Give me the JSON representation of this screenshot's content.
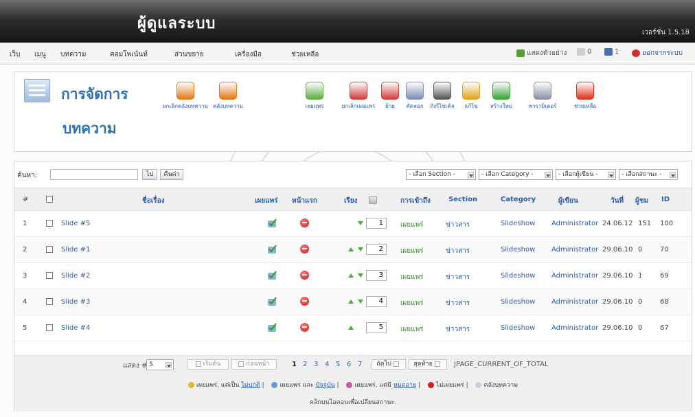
{
  "header": {
    "brand": "ผู้ดูแลระบบ",
    "version": "เวอร์ชั่น 1.5.18"
  },
  "menu": {
    "items": [
      "เว็บ",
      "เมนู",
      "บทความ",
      "คอมโพเน้นท์",
      "ส่วนขยาย",
      "เครื่องมือ",
      "ช่วยเหลือ"
    ],
    "preview": "แสดงตัวอย่าง",
    "messages": "0",
    "users": "1",
    "logout": "ออกจากระบบ"
  },
  "page": {
    "title_line1": "การจัดการ",
    "title_line2": "บทความ"
  },
  "toolbar": [
    {
      "label": "ยกเลิกคลังบทความ",
      "icon": "unarchive-icon",
      "color": "#e07a18"
    },
    {
      "label": "คลังบทความ",
      "icon": "archive-icon",
      "color": "#e07a18"
    },
    {
      "label": "เผยแพร่",
      "icon": "publish-icon",
      "color": "#5bae3f"
    },
    {
      "label": "ยกเลิกเผยแพร่",
      "icon": "unpublish-icon",
      "color": "#d23c3c"
    },
    {
      "label": "ย้าย",
      "icon": "move-icon",
      "color": "#d23c3c"
    },
    {
      "label": "คัดลอก",
      "icon": "copy-icon",
      "color": "#7a8fb5"
    },
    {
      "label": "ถังรีไซเคิล",
      "icon": "trash-icon",
      "color": "#555555"
    },
    {
      "label": "แก้ไข",
      "icon": "edit-icon",
      "color": "#e2a21b"
    },
    {
      "label": "สร้างใหม่",
      "icon": "new-icon",
      "color": "#3aa635"
    },
    {
      "label": "พารามิเตอร์",
      "icon": "params-icon",
      "color": "#8a8fa5"
    },
    {
      "label": "ช่วยเหลือ",
      "icon": "help-icon",
      "color": "#e0321e"
    }
  ],
  "filter": {
    "label": "ค้นหา:",
    "search_value": "",
    "go_label": "ไป",
    "reset_label": "คืนค่า",
    "section": "- เลือก Section -",
    "category": "- เลือก Category -",
    "author": "- เลือกผู้เขียน -",
    "state": "- เลือกสถานะ -"
  },
  "table": {
    "headers": {
      "num": "#",
      "title": "ชื่อเรื่อง",
      "published": "เผยแพร่",
      "frontpage": "หน้าแรก",
      "order": "เรียง",
      "access": "การเข้าถึง",
      "section": "Section",
      "category": "Category",
      "author": "ผู้เขียน",
      "date": "วันที่",
      "hits": "ผู้ชม",
      "id": "ID"
    },
    "rows": [
      {
        "num": "1",
        "title": "Slide #5",
        "order": "1",
        "access": "เผยแพร่",
        "section": "ข่าวสาร",
        "category": "Slideshow",
        "author": "Administrator",
        "date": "24.06.12",
        "hits": "151",
        "id": "100"
      },
      {
        "num": "2",
        "title": "Slide #1",
        "order": "2",
        "access": "เผยแพร่",
        "section": "ข่าวสาร",
        "category": "Slideshow",
        "author": "Administrator",
        "date": "29.06.10",
        "hits": "0",
        "id": "70"
      },
      {
        "num": "3",
        "title": "Slide #2",
        "order": "3",
        "access": "เผยแพร่",
        "section": "ข่าวสาร",
        "category": "Slideshow",
        "author": "Administrator",
        "date": "29.06.10",
        "hits": "1",
        "id": "69"
      },
      {
        "num": "4",
        "title": "Slide #3",
        "order": "4",
        "access": "เผยแพร่",
        "section": "ข่าวสาร",
        "category": "Slideshow",
        "author": "Administrator",
        "date": "29.06.10",
        "hits": "0",
        "id": "68"
      },
      {
        "num": "5",
        "title": "Slide #4",
        "order": "5",
        "access": "เผยแพร่",
        "section": "ข่าวสาร",
        "category": "Slideshow",
        "author": "Administrator",
        "date": "29.06.10",
        "hits": "0",
        "id": "67"
      }
    ]
  },
  "pagination": {
    "display_label": "แสดง #",
    "display_value": "5",
    "start": "เริ่มต้น",
    "prev": "ก่อนหน้า",
    "pages": [
      "1",
      "2",
      "3",
      "4",
      "5",
      "6",
      "7"
    ],
    "current": "1",
    "next": "ถัดไป",
    "end": "สุดท้าย",
    "counter": "JPAGE_CURRENT_OF_TOTAL"
  },
  "legend": {
    "pending_prefix": "เผยแพร่, แต่เป็น ",
    "pending_link": "ไม่ปกติ",
    "current_prefix": "เผยแพร่ และ ",
    "current_link": "ปัจจุบัน",
    "expired_prefix": "เผยแพร่, แต่มี ",
    "expired_link": "หมดอายุ",
    "unpublished": "ไม่เผยแพร่",
    "archived": "คลังบทความ",
    "hint": "คลิกบนไอคอนเพื่อเปลี่ยนสถานะ."
  }
}
